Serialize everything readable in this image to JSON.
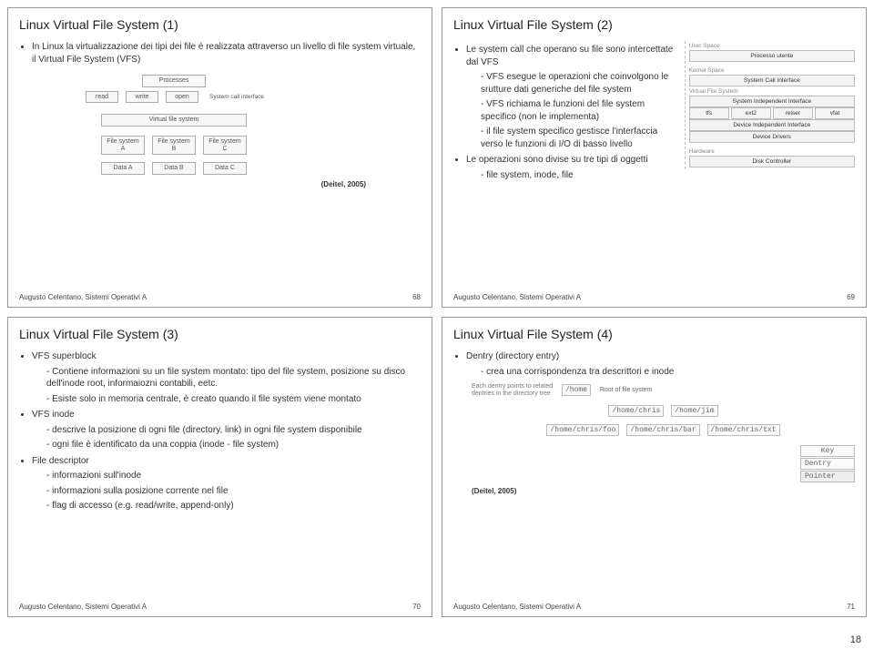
{
  "page_number": "18",
  "footer_author": "Augusto Celentano, Sistemi Operativi A",
  "credit": "(Deitel, 2005)",
  "slide1": {
    "title": "Linux Virtual File System (1)",
    "bullet1": "In Linux la virtualizzazione dei tipi dei file è realizzata attraverso un livello di file system virtuale, il Virtual File System (VFS)",
    "num": "68",
    "diag": {
      "processes": "Processes",
      "read": "read",
      "write": "write",
      "open": "open",
      "sci": "System call interface",
      "vfs": "Virtual file system",
      "fsa": "File system A",
      "fsb": "File system B",
      "fsc": "File system C",
      "da": "Data A",
      "db": "Data B",
      "dc": "Data C"
    }
  },
  "slide2": {
    "title": "Linux Virtual File System (2)",
    "b1": "Le system call che operano su file sono intercettate dal VFS",
    "b1a": "VFS esegue le operazioni che coinvolgono le srutture dati generiche del file system",
    "b1b": "VFS richiama le funzioni del file system specifico (non le implementa)",
    "b1c": "il file system specifico gestisce l'interfaccia verso le funzioni di I/O di basso livello",
    "b2": "Le operazioni sono divise su tre tipi di oggetti",
    "b2a": "file system, inode, file",
    "num": "69",
    "diag": {
      "user_space": "User Space",
      "proc_utente": "Processo utente",
      "kernel_space": "Kernel Space",
      "sci": "System Call Interface",
      "vfs_lbl": "Virtual File System",
      "sii": "System Independent Interface",
      "tfs": "tfs",
      "ext2": "ext2",
      "reiser": "reiser",
      "vfat": "vfat",
      "dii": "Device Independent Interface",
      "drv": "Device Drivers",
      "hw": "Hardware",
      "disk": "Disk Controller"
    }
  },
  "slide3": {
    "title": "Linux Virtual File System (3)",
    "h1": "VFS superblock",
    "h1a": "Contiene informazioni su un file system montato: tipo del file system, posizione su disco dell'inode root, informaiozni contabili, eetc.",
    "h1b": "Esiste solo in memoria centrale, è creato quando il file system viene montato",
    "h2": "VFS inode",
    "h2a": "descrive la posizione di ogni file (directory, link) in ogni file system disponibile",
    "h2b": "ogni file è identificato da una coppia (inode - file system)",
    "h3": "File descriptor",
    "h3a": "informazioni sull'inode",
    "h3b": "informazioni sulla posizione corrente nel file",
    "h3c": "flag di accesso (e.g. read/write, append-only)",
    "num": "70"
  },
  "slide4": {
    "title": "Linux Virtual File System (4)",
    "b1": "Dentry (directory entry)",
    "b1a": "crea una corrispondenza tra descrittori e inode",
    "num": "71",
    "diag": {
      "note": "Each dentry points to related dentries in the directory tree",
      "home": "/home",
      "root_lbl": "Root of file system",
      "chris": "/home/chris",
      "jim": "/home/jim",
      "foo": "/home/chris/foo",
      "bar": "/home/chris/bar",
      "txt": "/home/chris/txt",
      "key": "Key",
      "dentry": "Dentry",
      "pointer": "Pointer"
    }
  }
}
